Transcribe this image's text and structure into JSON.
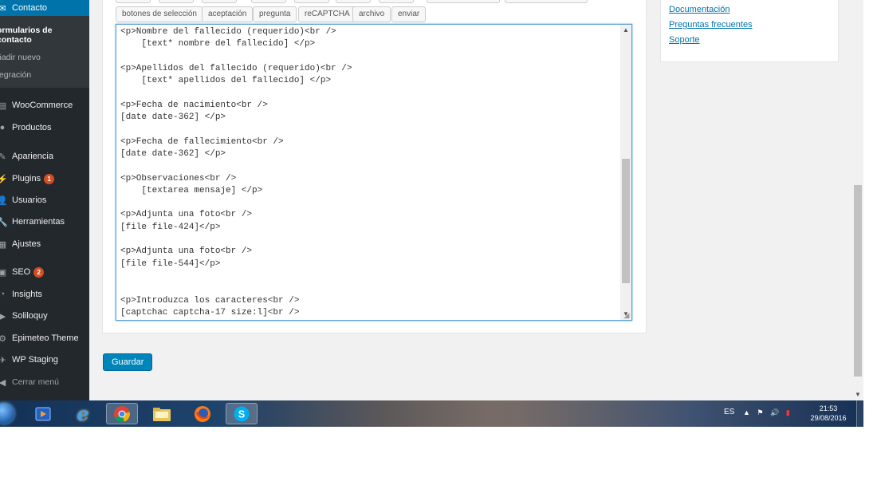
{
  "sidebar": {
    "active_menu": "Contacto",
    "submenu": [
      "ormularios de contacto",
      "ñadir nuevo",
      "tegración"
    ],
    "items": [
      {
        "label": "WooCommerce",
        "icon": "woocommerce-icon"
      },
      {
        "label": "Productos",
        "icon": "products-icon"
      },
      {
        "label": "Apariencia",
        "icon": "appearance-icon"
      },
      {
        "label": "Plugins",
        "icon": "plugins-icon",
        "badge": "1"
      },
      {
        "label": "Usuarios",
        "icon": "users-icon"
      },
      {
        "label": "Herramientas",
        "icon": "tools-icon"
      },
      {
        "label": "Ajustes",
        "icon": "settings-icon"
      },
      {
        "label": "SEO",
        "icon": "seo-icon",
        "badge": "2"
      },
      {
        "label": "Insights",
        "icon": "insights-icon"
      },
      {
        "label": "Soliloquy",
        "icon": "soliloquy-icon"
      },
      {
        "label": "Epimeteo Theme",
        "icon": "theme-icon"
      },
      {
        "label": "WP Staging",
        "icon": "staging-icon"
      }
    ],
    "collapse": "Cerrar menú"
  },
  "tag_buttons": [
    "botones de selección",
    "aceptación",
    "pregunta",
    "reCAPTCHA",
    "archivo",
    "enviar"
  ],
  "editor_lines": [
    "<p>Nombre del fallecido (requerido)<br />",
    "    [text* nombre del fallecido] </p>",
    "",
    "<p>Apellidos del fallecido (requerido)<br />",
    "    [text* apellidos del fallecido] </p>",
    "",
    "<p>Fecha de nacimiento<br />",
    "[date date-362] </p>",
    "",
    "<p>Fecha de fallecimiento<br />",
    "[date date-362] </p>",
    "",
    "<p>Observaciones<br />",
    "    [textarea mensaje] </p>",
    "",
    "<p>Adjunta una foto<br />",
    "[file file-424]</p>",
    "",
    "<p>Adjunta una foto<br />",
    "[file file-544]</p>",
    "",
    "",
    "<p>Introduzca los caracteres<br />",
    "[captchac captcha-17 size:l]<br />"
  ],
  "save_button": "Guardar",
  "help_links": [
    "Documentación",
    "Preguntas frecuentes",
    "Soporte"
  ],
  "taskbar": {
    "apps": [
      {
        "name": "media-player-icon"
      },
      {
        "name": "internet-explorer-icon"
      },
      {
        "name": "chrome-icon",
        "active": true
      },
      {
        "name": "file-explorer-icon"
      },
      {
        "name": "firefox-icon"
      },
      {
        "name": "skype-icon",
        "active": true
      }
    ],
    "language": "ES",
    "time": "21:53",
    "date": "29/08/2016"
  }
}
